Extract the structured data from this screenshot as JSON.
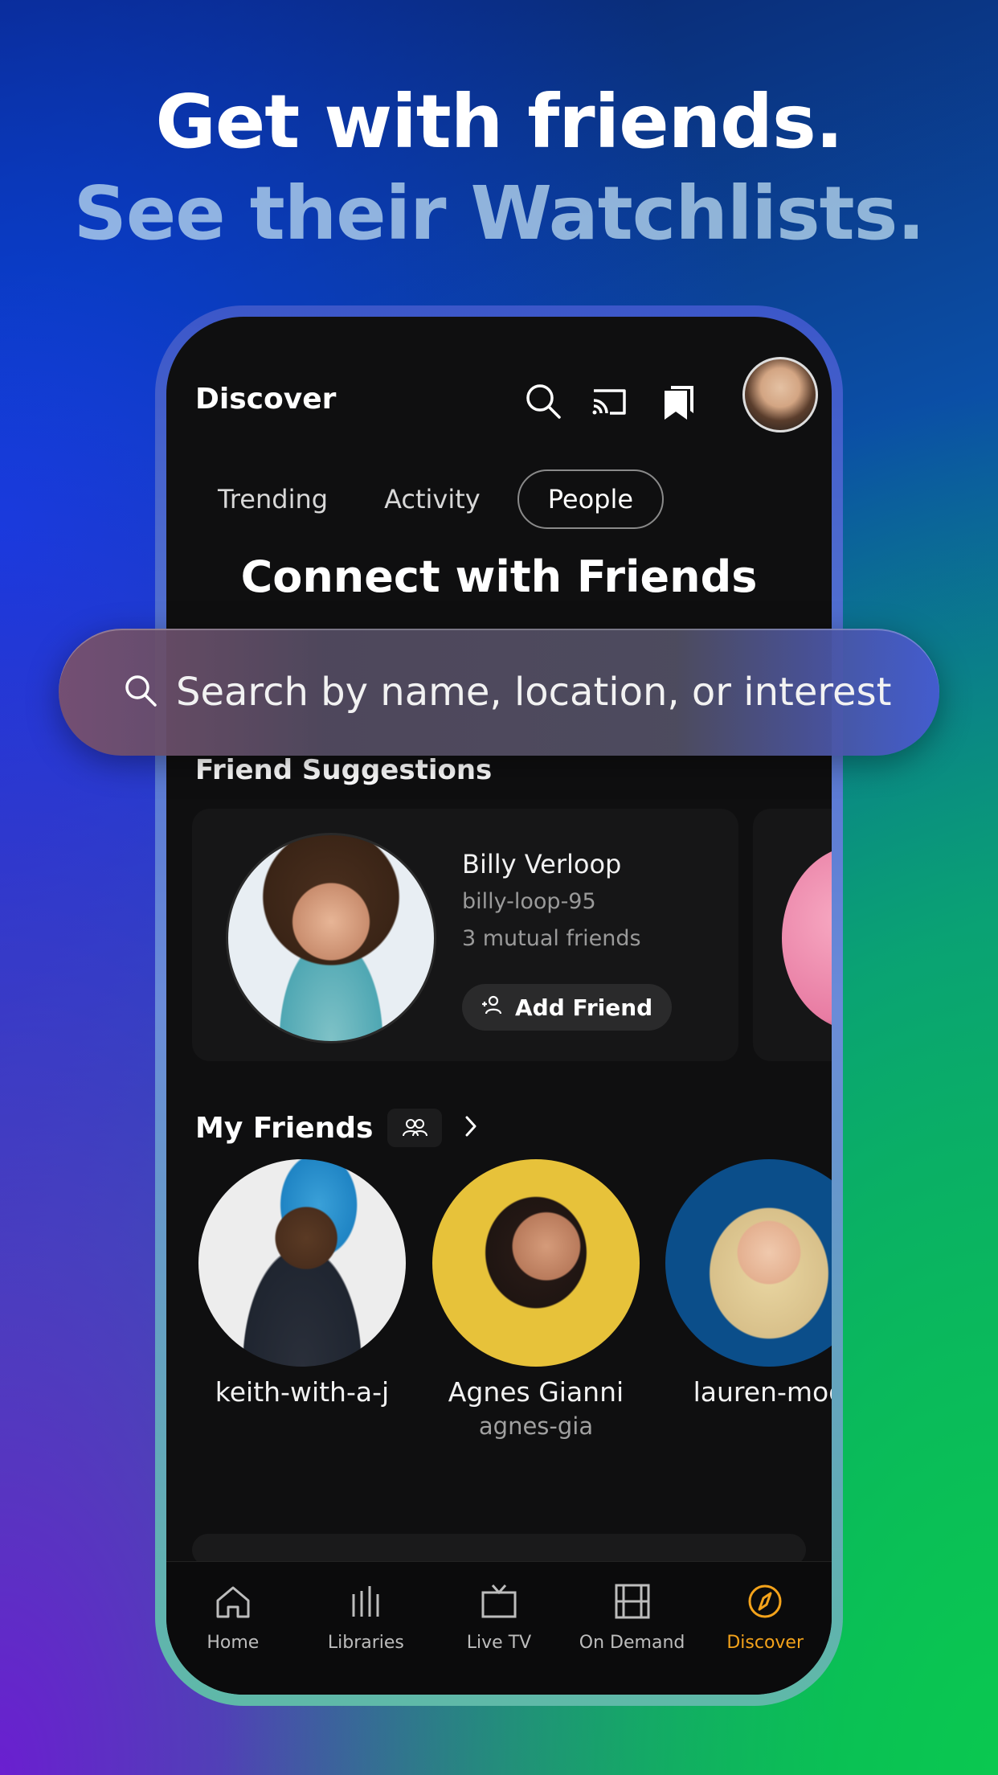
{
  "headline": {
    "line1": "Get with friends.",
    "line2": "See their Watchlists."
  },
  "header": {
    "title": "Discover",
    "icons": [
      "search-icon",
      "cast-icon",
      "watchlist-icon",
      "profile-avatar"
    ]
  },
  "tabs": [
    {
      "label": "Trending",
      "active": false
    },
    {
      "label": "Activity",
      "active": false
    },
    {
      "label": "People",
      "active": true
    }
  ],
  "connect_title": "Connect with Friends",
  "search": {
    "placeholder": "Search by name, location, or interest"
  },
  "suggestions": {
    "title": "Friend Suggestions",
    "items": [
      {
        "name": "Billy Verloop",
        "handle": "billy-loop-95",
        "mutual": "3 mutual friends",
        "button": "Add Friend"
      }
    ]
  },
  "friends": {
    "title": "My Friends",
    "items": [
      {
        "name": "keith-with-a-j",
        "handle": ""
      },
      {
        "name": "Agnes Gianni",
        "handle": "agnes-gia"
      },
      {
        "name": "lauren-moo",
        "handle": ""
      }
    ]
  },
  "nav": [
    {
      "label": "Home",
      "icon": "home-icon",
      "active": false
    },
    {
      "label": "Libraries",
      "icon": "libraries-icon",
      "active": false
    },
    {
      "label": "Live TV",
      "icon": "tv-icon",
      "active": false
    },
    {
      "label": "On Demand",
      "icon": "film-icon",
      "active": false
    },
    {
      "label": "Discover",
      "icon": "compass-icon",
      "active": true
    }
  ],
  "colors": {
    "accent": "#f4a31b",
    "screen_bg": "#0f0f10"
  }
}
